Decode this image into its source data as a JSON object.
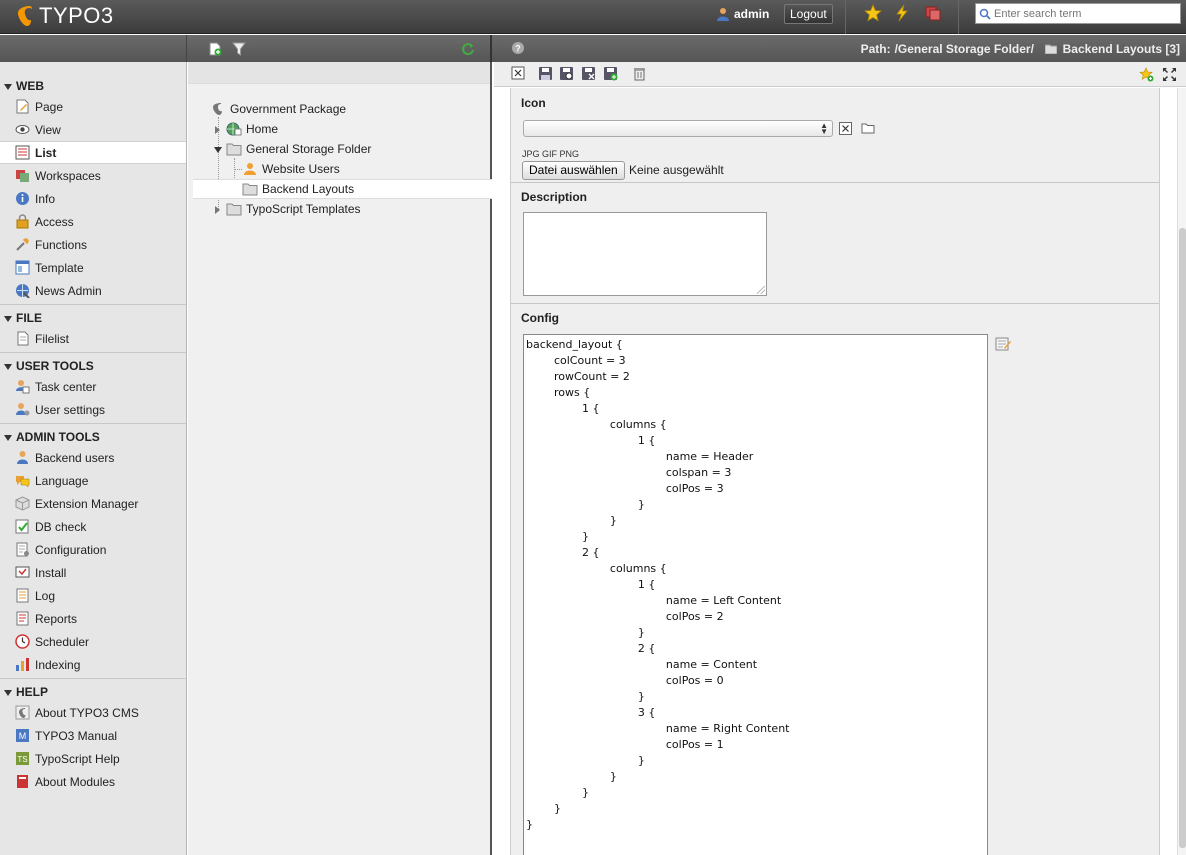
{
  "topbar": {
    "brand": "TYPO3",
    "username": "admin",
    "logout_label": "Logout",
    "search_placeholder": "Enter search term"
  },
  "path": {
    "label": "Path:",
    "folder": "/General Storage Folder/",
    "current": "Backend Layouts [3]"
  },
  "menu": {
    "groups": [
      {
        "title": "WEB",
        "items": [
          "Page",
          "View",
          "List",
          "Workspaces",
          "Info",
          "Access",
          "Functions",
          "Template",
          "News Admin"
        ]
      },
      {
        "title": "FILE",
        "items": [
          "Filelist"
        ]
      },
      {
        "title": "USER TOOLS",
        "items": [
          "Task center",
          "User settings"
        ]
      },
      {
        "title": "ADMIN TOOLS",
        "items": [
          "Backend users",
          "Language",
          "Extension Manager",
          "DB check",
          "Configuration",
          "Install",
          "Log",
          "Reports",
          "Scheduler",
          "Indexing"
        ]
      },
      {
        "title": "HELP",
        "items": [
          "About TYPO3 CMS",
          "TYPO3 Manual",
          "TypoScript Help",
          "About Modules"
        ]
      }
    ],
    "active": "List"
  },
  "tree": {
    "root": "Government Package",
    "nodes": [
      "Home",
      "General Storage Folder",
      "Website Users",
      "Backend Layouts",
      "TypoScript Templates"
    ],
    "selected": "Backend Layouts"
  },
  "form": {
    "icon_label": "Icon",
    "icon_selected": "",
    "filetypes": "JPG GIF PNG",
    "file_button": "Datei auswählen",
    "file_none": "Keine ausgewählt",
    "description_label": "Description",
    "description_value": "",
    "config_label": "Config",
    "config_value": "backend_layout {\n\tcolCount = 3\n\trowCount = 2\n\trows {\n\t\t1 {\n\t\t\tcolumns {\n\t\t\t\t1 {\n\t\t\t\t\tname = Header\n\t\t\t\t\tcolspan = 3\n\t\t\t\t\tcolPos = 3\n\t\t\t\t}\n\t\t\t}\n\t\t}\n\t\t2 {\n\t\t\tcolumns {\n\t\t\t\t1 {\n\t\t\t\t\tname = Left Content\n\t\t\t\t\tcolPos = 2\n\t\t\t\t}\n\t\t\t\t2 {\n\t\t\t\t\tname = Content\n\t\t\t\t\tcolPos = 0\n\t\t\t\t}\n\t\t\t\t3 {\n\t\t\t\t\tname = Right Content\n\t\t\t\t\tcolPos = 1\n\t\t\t\t}\n\t\t\t}\n\t\t}\n\t}\n}"
  },
  "colors": {
    "topbar": "#3c3c3c",
    "brand_orange": "#f49700",
    "menu_bg": "#e6e6e6",
    "tree_bg": "#f0f0f0",
    "form_bg": "#efefef"
  }
}
